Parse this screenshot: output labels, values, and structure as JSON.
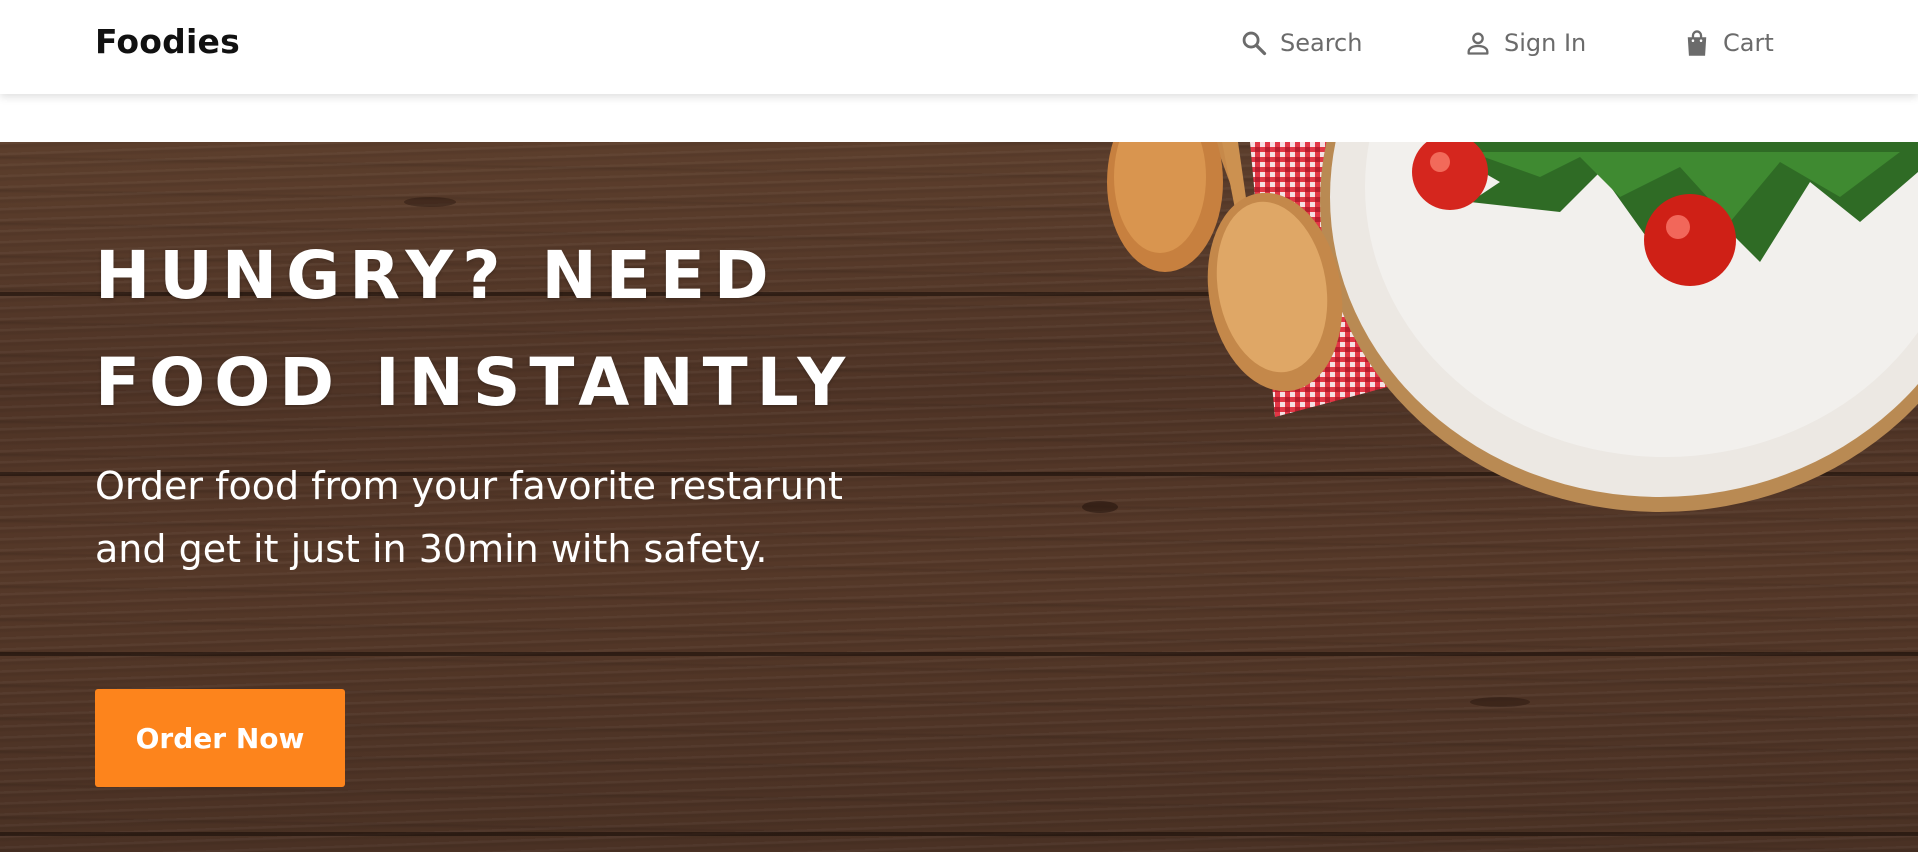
{
  "brand": "Foodies",
  "nav": {
    "search": {
      "label": "Search",
      "icon": "search-icon"
    },
    "signin": {
      "label": "Sign In",
      "icon": "person-icon"
    },
    "cart": {
      "label": "Cart",
      "icon": "shopping-bag-icon"
    }
  },
  "hero": {
    "title_line1": "HUNGRY? NEED",
    "title_line2": "FOOD INSTANTLY",
    "subtitle": "Order food from your favorite restarunt and get it just in 30min with safety.",
    "cta_label": "Order Now"
  },
  "colors": {
    "accent": "#fd841c",
    "nav_text": "#6b6b6b",
    "brand_text": "#111111",
    "wood": "#533829"
  }
}
